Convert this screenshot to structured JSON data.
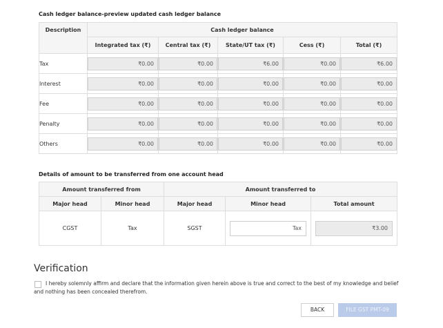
{
  "cash_ledger": {
    "title": "Cash ledger balance-preview updated cash ledger balance",
    "header_description": "Description",
    "header_group": "Cash ledger balance",
    "columns": [
      "Integrated tax (₹)",
      "Central tax (₹)",
      "State/UT tax (₹)",
      "Cess (₹)",
      "Total (₹)"
    ],
    "rows": [
      {
        "label": "Tax",
        "values": [
          "₹0.00",
          "₹0.00",
          "₹6.00",
          "₹0.00",
          "₹6.00"
        ]
      },
      {
        "label": "Interest",
        "values": [
          "₹0.00",
          "₹0.00",
          "₹0.00",
          "₹0.00",
          "₹0.00"
        ]
      },
      {
        "label": "Fee",
        "values": [
          "₹0.00",
          "₹0.00",
          "₹0.00",
          "₹0.00",
          "₹0.00"
        ]
      },
      {
        "label": "Penalty",
        "values": [
          "₹0.00",
          "₹0.00",
          "₹0.00",
          "₹0.00",
          "₹0.00"
        ]
      },
      {
        "label": "Others",
        "values": [
          "₹0.00",
          "₹0.00",
          "₹0.00",
          "₹0.00",
          "₹0.00"
        ]
      }
    ]
  },
  "transfer": {
    "title": "Details of amount to be transferred from one account head",
    "group_from": "Amount transferred from",
    "group_to": "Amount transferred to",
    "col_major_from": "Major head",
    "col_minor_from": "Minor head",
    "col_major_to": "Major head",
    "col_minor_to": "Minor head",
    "col_total": "Total amount",
    "row": {
      "major_from": "CGST",
      "minor_from": "Tax",
      "major_to": "SGST",
      "minor_to_value": "Tax",
      "total_amount": "₹3.00"
    }
  },
  "verification": {
    "title": "Verification",
    "declaration": "I hereby solemnly affirm and declare that the information given herein above is true and correct to the best of my knowledge and belief and nothing has been concealed therefrom.",
    "checked": false
  },
  "buttons": {
    "back": "BACK",
    "file": "FILE GST PMT-09"
  }
}
